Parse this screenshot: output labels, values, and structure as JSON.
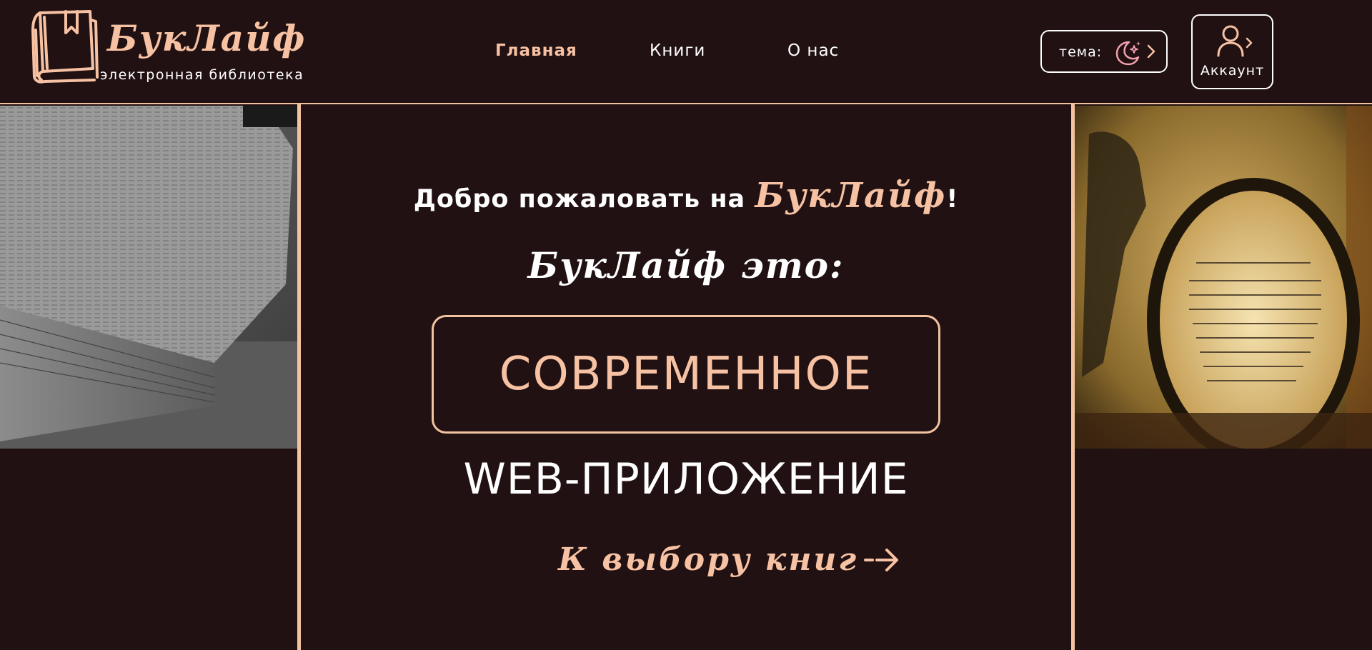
{
  "logo": {
    "name": "БукЛайф",
    "subtitle": "электронная библиотека"
  },
  "nav": {
    "items": [
      {
        "label": "Главная",
        "active": true
      },
      {
        "label": "Книги",
        "active": false
      },
      {
        "label": "О нас",
        "active": false
      }
    ]
  },
  "theme": {
    "label": "тема:",
    "icon": "moon-stars-icon"
  },
  "account": {
    "label": "Аккаунт",
    "icon": "user-icon"
  },
  "hero": {
    "welcome_prefix": "Добро пожаловать на ",
    "welcome_brand": "БукЛайф",
    "welcome_suffix": "!",
    "tagline": "БукЛайф это:",
    "highlight": "СОВРЕМЕННОЕ",
    "subline": "WEB-ПРИЛОЖЕНИЕ",
    "cta": "К выбору книг"
  },
  "colors": {
    "background": "#211112",
    "accent": "#f7c2a3",
    "text": "#ffffff"
  }
}
